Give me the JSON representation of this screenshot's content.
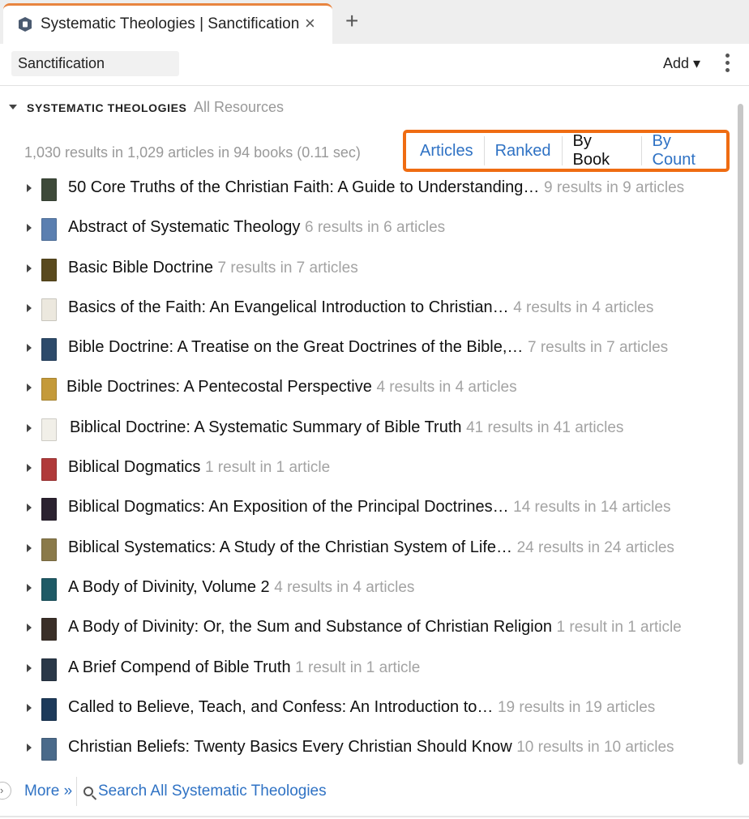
{
  "tab": {
    "title": "Systematic Theologies | Sanctification",
    "close_glyph": "×",
    "new_tab_glyph": "+",
    "accent": "#e8843f"
  },
  "header": {
    "search_value": "Sanctification",
    "add_label": "Add ▾"
  },
  "section": {
    "title": "SYSTEMATIC THEOLOGIES",
    "subtitle": "All Resources"
  },
  "summary": "1,030 results in 1,029 articles in 94 books (0.11 sec)",
  "views": [
    {
      "label": "Articles",
      "active": false
    },
    {
      "label": "Ranked",
      "active": false
    },
    {
      "label": "By Book",
      "active": true
    },
    {
      "label": "By Count",
      "active": false
    }
  ],
  "highlight_color": "#ef6c12",
  "link_color": "#2f72c4",
  "results": [
    {
      "title": "50 Core Truths of the Christian Faith: A Guide to Understanding…",
      "count": "9 results in 9 articles",
      "cover": "#3e4a3a"
    },
    {
      "title": "Abstract of Systematic Theology",
      "count": "6 results in 6 articles",
      "cover": "#5b7fb0"
    },
    {
      "title": "Basic Bible Doctrine",
      "count": "7 results in 7 articles",
      "cover": "#5a4a1e"
    },
    {
      "title": "Basics of the Faith: An Evangelical Introduction to Christian…",
      "count": "4 results in 4 articles",
      "cover": "#ece8de"
    },
    {
      "title": "Bible Doctrine: A Treatise on the Great Doctrines of the Bible,…",
      "count": "7 results in 7 articles",
      "cover": "#2d4a6a"
    },
    {
      "title": "Bible Doctrines: A Pentecostal Perspective",
      "count": "4 results in 4 articles",
      "cover": "#c49a3a"
    },
    {
      "title": "Biblical Doctrine: A Systematic Summary of Bible Truth",
      "count": "41 results in 41 articles",
      "cover": "#f1efe8"
    },
    {
      "title": "Biblical Dogmatics",
      "count": "1 result in 1 article",
      "cover": "#b03a3a"
    },
    {
      "title": "Biblical Dogmatics: An Exposition of the Principal Doctrines…",
      "count": "14 results in 14 articles",
      "cover": "#2b2230"
    },
    {
      "title": "Biblical Systematics: A Study of the Christian System of Life…",
      "count": "24 results in 24 articles",
      "cover": "#8a7a4a"
    },
    {
      "title": "A Body of Divinity, Volume 2",
      "count": "4 results in 4 articles",
      "cover": "#1e5a66"
    },
    {
      "title": "A Body of Divinity: Or, the Sum and Substance of Christian Religion",
      "count": "1 result in 1 article",
      "cover": "#3a2f28"
    },
    {
      "title": "A Brief Compend of Bible Truth",
      "count": "1 result in 1 article",
      "cover": "#2a3848"
    },
    {
      "title": "Called to Believe, Teach, and Confess: An Introduction to…",
      "count": "19 results in 19 articles",
      "cover": "#1d3a5a"
    },
    {
      "title": "Christian Beliefs: Twenty Basics Every Christian Should Know",
      "count": "10 results in 10 articles",
      "cover": "#4a6a8a"
    }
  ],
  "footer": {
    "more_label": "More »",
    "search_all_label": "Search All Systematic Theologies"
  }
}
